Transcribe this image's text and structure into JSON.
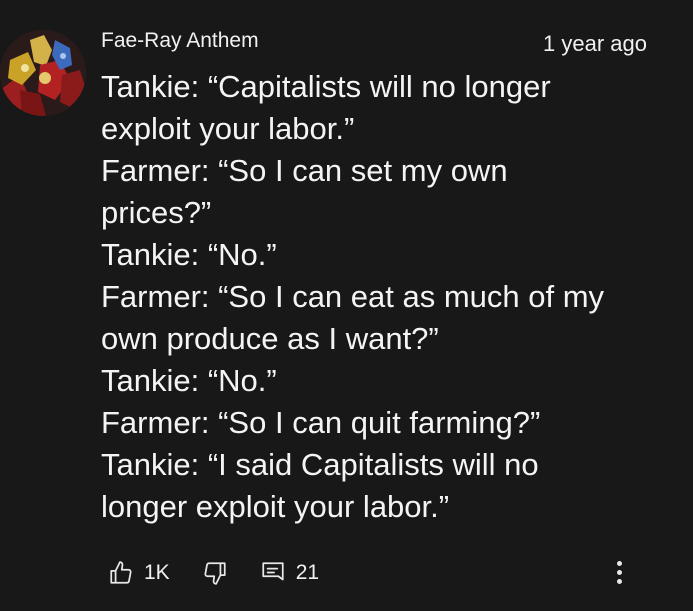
{
  "comment": {
    "author": "Fae-Ray Anthem",
    "timestamp": "1 year ago",
    "lines": [
      "Tankie: “Capitalists will no longer",
      "exploit your labor.”",
      "Farmer: “So I can set my own",
      "prices?”",
      "Tankie: “No.”",
      "Farmer: “So I can eat as much of my",
      "own produce as I want?”",
      "Tankie: “No.”",
      "Farmer: “So I can quit farming?”",
      "Tankie: “I said Capitalists will no",
      "longer exploit your labor.”"
    ],
    "actions": {
      "like_count": "1K",
      "like_icon": "thumbs-up-icon",
      "dislike_icon": "thumbs-down-icon",
      "reply_count": "21",
      "reply_icon": "comment-icon",
      "more_icon": "more-vertical-icon"
    }
  },
  "colors": {
    "background": "#181818",
    "text": "#f1f1f1"
  }
}
